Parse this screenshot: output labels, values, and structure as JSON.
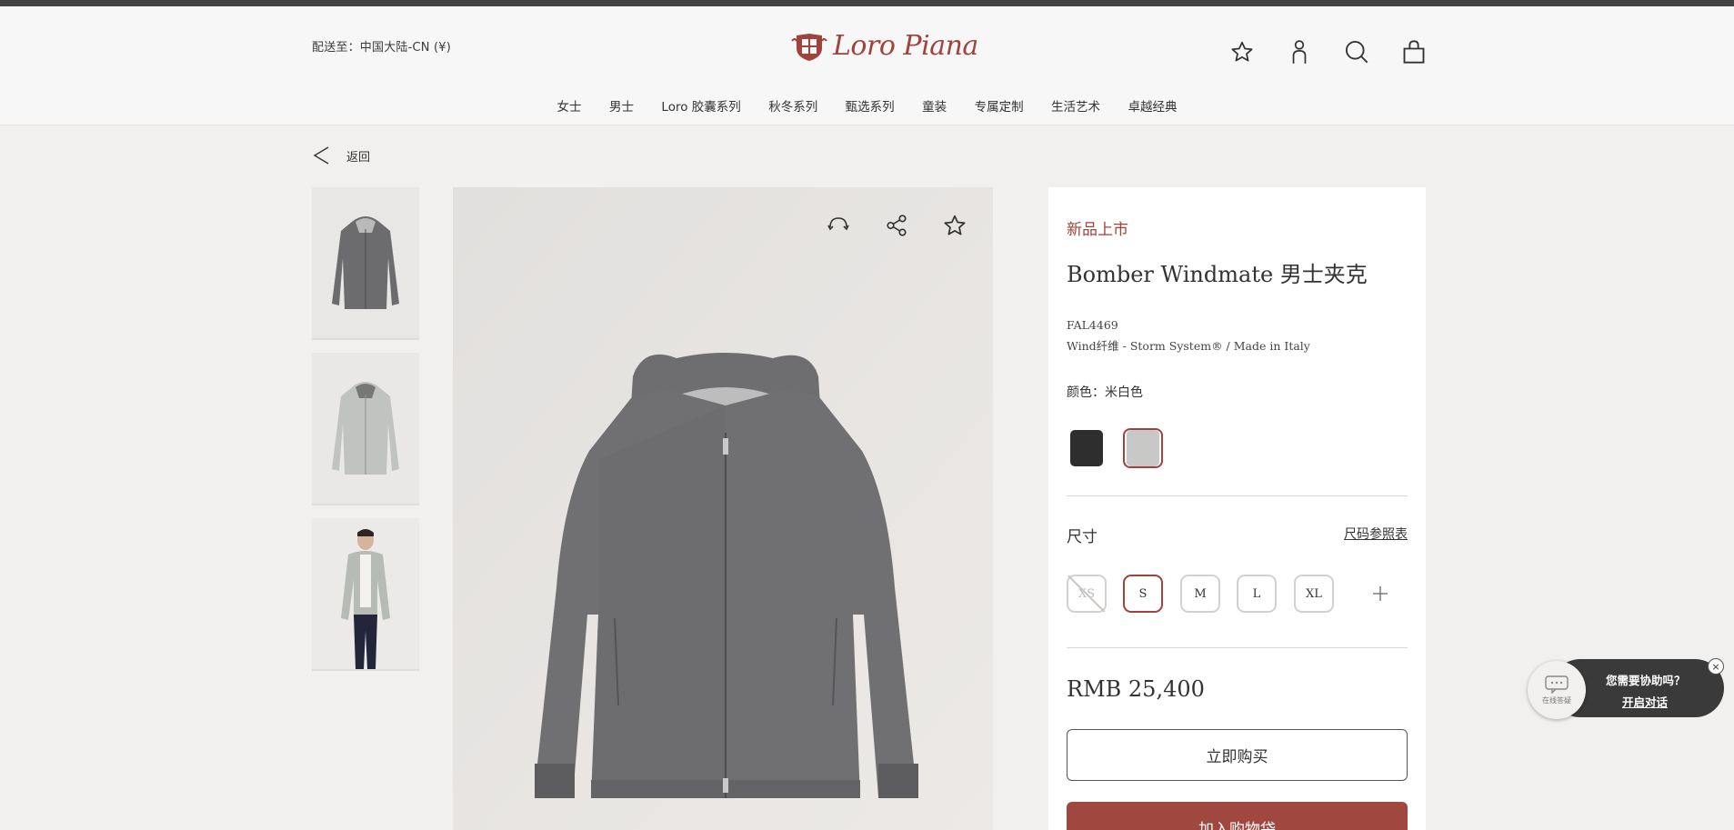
{
  "header": {
    "shipping": "配送至：中国大陆-CN (¥)",
    "brand": "Loro Piana",
    "nav": [
      "女士",
      "男士",
      "Loro 胶囊系列",
      "秋冬系列",
      "甄选系列",
      "童装",
      "专属定制",
      "生活艺术",
      "卓越经典"
    ],
    "icons": [
      "star-icon",
      "user-icon",
      "search-icon",
      "bag-icon"
    ]
  },
  "back_label": "返回",
  "gallery": {
    "thumbnails": [
      "jacket-front",
      "jacket-reverse",
      "model-wearing"
    ],
    "image_actions": [
      "rotate-360-icon",
      "share-icon",
      "favorite-star-icon"
    ]
  },
  "product": {
    "tag": "新品上市",
    "title": "Bomber Windmate 男士夹克",
    "sku": "FAL4469",
    "material": "Wind纤维 - Storm System® / Made in Italy",
    "color_label": "颜色：米白色",
    "colors": [
      "#2e2e2e",
      "#c8c9c6"
    ],
    "size_label": "尺寸",
    "size_guide": "尺码参照表",
    "sizes": [
      {
        "label": "XS",
        "state": "unavailable"
      },
      {
        "label": "S",
        "state": "selected"
      },
      {
        "label": "M",
        "state": "available"
      },
      {
        "label": "L",
        "state": "available"
      },
      {
        "label": "XL",
        "state": "available"
      }
    ],
    "price": "RMB 25,400",
    "buy_now": "立即购买",
    "add_to_bag": "加入购物袋"
  },
  "chat": {
    "avatar_label": "在线答疑",
    "question": "您需要协助吗？",
    "link": "开启对话",
    "close": "×"
  },
  "colors": {
    "accent": "#a0433c",
    "topbar": "#434343"
  }
}
